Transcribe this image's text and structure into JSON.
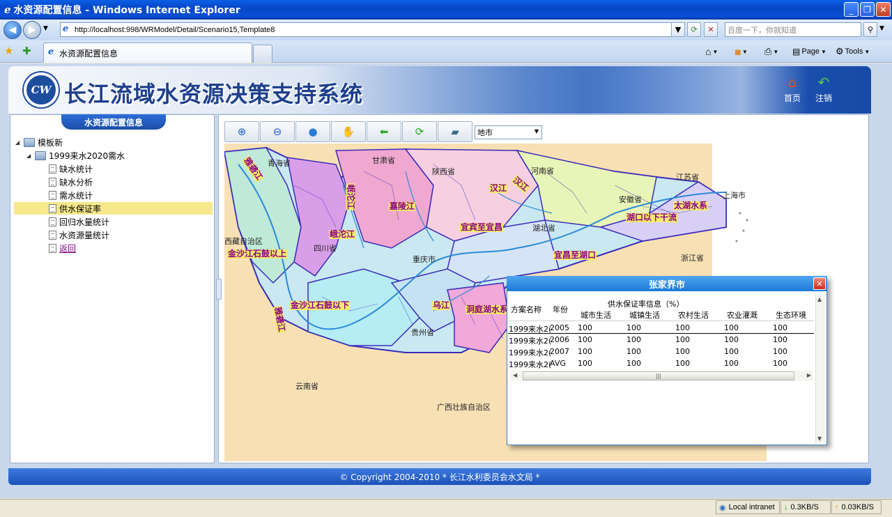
{
  "browser": {
    "window_title": "水资源配置信息 - Windows Internet Explorer",
    "address": "http://localhost:998/WRModel/Detail/Scenario15,Template8",
    "search_placeholder": "百度一下，你就知道",
    "tab_title": "水资源配置信息",
    "toolbar": {
      "page": "Page",
      "tools": "Tools"
    }
  },
  "header": {
    "system_title": "长江流域水资源决策支持系统",
    "logo_text": "CW",
    "home": "首页",
    "logout": "注销"
  },
  "sidebar": {
    "title": "水资源配置信息",
    "root": "模板新",
    "scenario": "1999来水2020需水",
    "items": [
      {
        "label": "缺水统计",
        "selected": false
      },
      {
        "label": "缺水分析",
        "selected": false
      },
      {
        "label": "需水统计",
        "selected": false
      },
      {
        "label": "供水保证率",
        "selected": true
      },
      {
        "label": "回归水量统计",
        "selected": false
      },
      {
        "label": "水资源量统计",
        "selected": false
      },
      {
        "label": "返回",
        "link": true
      }
    ]
  },
  "map_toolbar": {
    "buttons": [
      "zoom-in-icon",
      "zoom-out-icon",
      "globe-icon",
      "pan-hand-icon",
      "back-arrow-icon",
      "refresh-icon",
      "layers-icon"
    ],
    "layer_select": "地市"
  },
  "map": {
    "provinces": [
      "青海省",
      "甘肃省",
      "陕西省",
      "河南省",
      "江苏省",
      "安徽省",
      "湖北省",
      "浙江省",
      "西藏自治区",
      "四川省",
      "重庆市",
      "贵州省",
      "云南省",
      "广西壮族自治区",
      "上海市"
    ],
    "regions": [
      "雅砻江",
      "岷沱江",
      "嘉陵江",
      "汉江",
      "汉江",
      "太湖水系",
      "湖口以下干流",
      "宜宾至宜昌",
      "峨沱江",
      "金沙江石鼓以上",
      "金沙江石鼓以下",
      "宜昌至湖口",
      "乌江",
      "洞庭湖水系",
      "雅砻江"
    ]
  },
  "popup": {
    "title": "张家界市",
    "group_header": "供水保证率信息（%）",
    "columns": [
      "方案名称",
      "年份",
      "城市生活",
      "城镇生活",
      "农村生活",
      "农业灌溉",
      "生态环境"
    ],
    "rows": [
      [
        "1999来水2(",
        "2005",
        "100",
        "100",
        "100",
        "100",
        "100"
      ],
      [
        "1999来水2(",
        "2006",
        "100",
        "100",
        "100",
        "100",
        "100"
      ],
      [
        "1999来水2(",
        "2007",
        "100",
        "100",
        "100",
        "100",
        "100"
      ],
      [
        "1999来水2(",
        "AVG",
        "100",
        "100",
        "100",
        "100",
        "100"
      ]
    ]
  },
  "footer": "© Copyright 2004-2010 * 长江水利委员会水文局 *",
  "statusbar": {
    "zone": "Local intranet",
    "down": "0.3KB/S",
    "up": "0.03KB/S"
  }
}
